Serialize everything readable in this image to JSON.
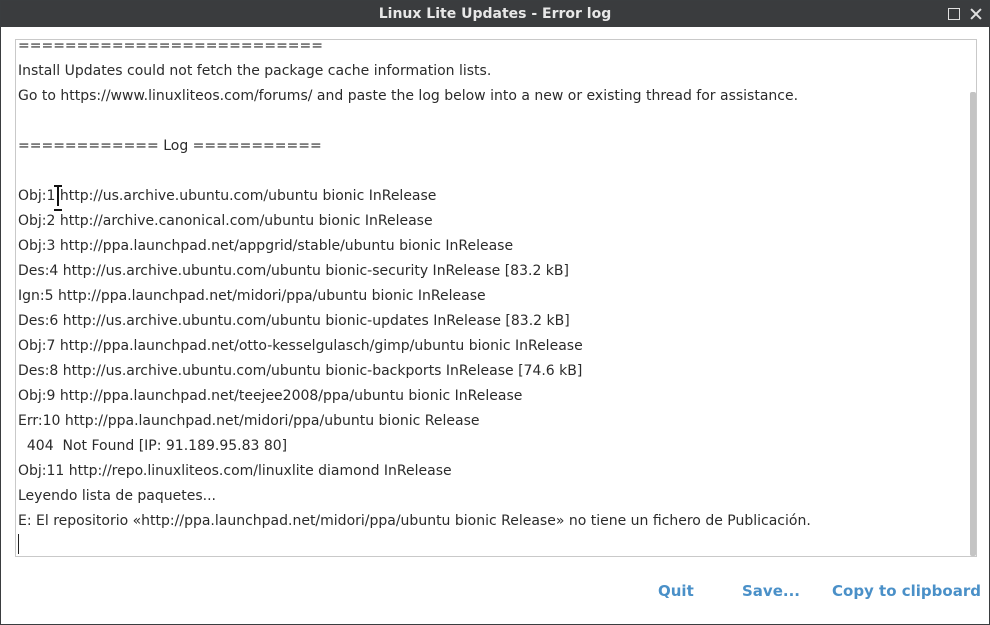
{
  "window": {
    "title": "Linux Lite Updates - Error log"
  },
  "log": {
    "lines": [
      "==========================",
      "Install Updates could not fetch the package cache information lists.",
      "Go to https://www.linuxliteos.com/forums/ and paste the log below into a new or existing thread for assistance.",
      "",
      "============ Log ===========",
      "",
      "Obj:1 http://us.archive.ubuntu.com/ubuntu bionic InRelease",
      "Obj:2 http://archive.canonical.com/ubuntu bionic InRelease",
      "Obj:3 http://ppa.launchpad.net/appgrid/stable/ubuntu bionic InRelease",
      "Des:4 http://us.archive.ubuntu.com/ubuntu bionic-security InRelease [83.2 kB]",
      "Ign:5 http://ppa.launchpad.net/midori/ppa/ubuntu bionic InRelease",
      "Des:6 http://us.archive.ubuntu.com/ubuntu bionic-updates InRelease [83.2 kB]",
      "Obj:7 http://ppa.launchpad.net/otto-kesselgulasch/gimp/ubuntu bionic InRelease",
      "Des:8 http://us.archive.ubuntu.com/ubuntu bionic-backports InRelease [74.6 kB]",
      "Obj:9 http://ppa.launchpad.net/teejee2008/ppa/ubuntu bionic InRelease",
      "Err:10 http://ppa.launchpad.net/midori/ppa/ubuntu bionic Release",
      "  404  Not Found [IP: 91.189.95.83 80]",
      "Obj:11 http://repo.linuxliteos.com/linuxlite diamond InRelease",
      "Leyendo lista de paquetes...",
      "E: El repositorio «http://ppa.launchpad.net/midori/ppa/ubuntu bionic Release» no tiene un fichero de Publicación."
    ]
  },
  "buttons": {
    "quit": "Quit",
    "save": "Save...",
    "copy": "Copy to clipboard"
  },
  "colors": {
    "titlebar": "#3a3c3e",
    "accent": "#4a90c8"
  }
}
